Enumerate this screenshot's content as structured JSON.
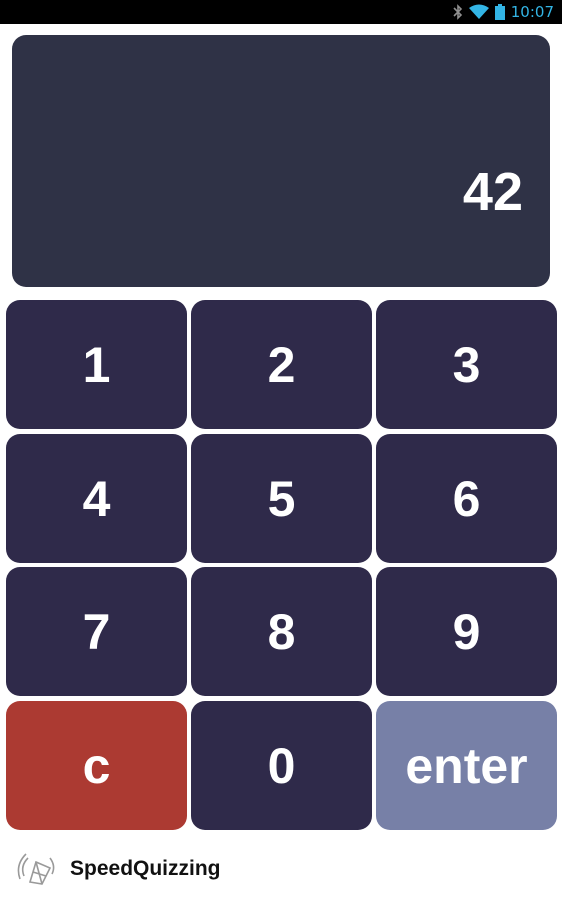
{
  "status_bar": {
    "time": "10:07",
    "icons": [
      "bluetooth-icon",
      "wifi-icon",
      "battery-icon"
    ],
    "accent_color": "#33b5e5"
  },
  "display": {
    "value": "42",
    "background": "#2f3246"
  },
  "keypad": {
    "keys": [
      {
        "label": "1"
      },
      {
        "label": "2"
      },
      {
        "label": "3"
      },
      {
        "label": "4"
      },
      {
        "label": "5"
      },
      {
        "label": "6"
      },
      {
        "label": "7"
      },
      {
        "label": "8"
      },
      {
        "label": "9"
      },
      {
        "label": "c"
      },
      {
        "label": "0"
      },
      {
        "label": "enter"
      }
    ],
    "colors": {
      "digit": "#2f2a4a",
      "clear": "#ac3a32",
      "enter": "#7780a7"
    }
  },
  "footer": {
    "logo_icon": "speedquizzing-logo-icon",
    "brand": "SpeedQuizzing"
  }
}
